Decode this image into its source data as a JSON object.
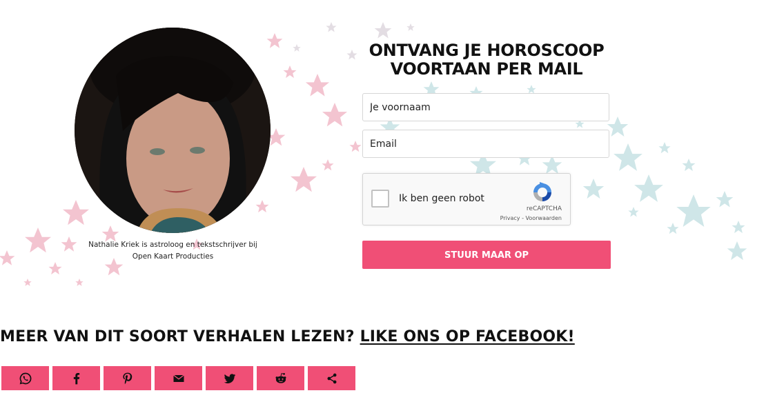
{
  "photo": {
    "caption": "Nathalie Kriek is astroloog en tekstschrijver bij Open Kaart Producties"
  },
  "form": {
    "title": "ONTVANG JE HOROSCOOP VOORTAAN PER MAIL",
    "first_name_placeholder": "Je voornaam",
    "email_placeholder": "Email",
    "captcha": {
      "label": "Ik ben geen robot",
      "brand": "reCAPTCHA",
      "links": "Privacy - Voorwaarden"
    },
    "submit_label": "STUUR MAAR OP"
  },
  "promo": {
    "text": "MEER VAN DIT SOORT VERHALEN LEZEN? ",
    "link_label": "LIKE ONS OP FACEBOOK!"
  },
  "share": {
    "buttons": [
      "whatsapp-icon",
      "facebook-icon",
      "pinterest-icon",
      "email-icon",
      "twitter-icon",
      "reddit-icon",
      "share-icon"
    ]
  },
  "colors": {
    "accent": "#f04f76",
    "star_pink": "#f3c4d0",
    "star_teal": "#cfe6e8"
  }
}
